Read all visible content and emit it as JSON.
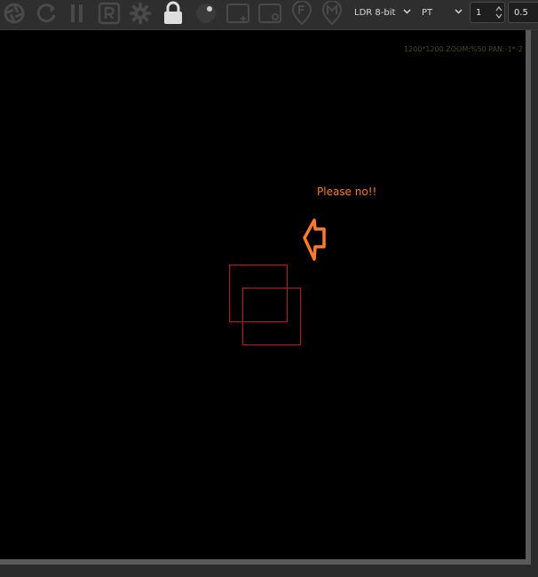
{
  "toolbar": {
    "icons": [
      "aperture-icon",
      "refresh-icon",
      "pause-icon",
      "render-r-icon",
      "settings-gear-icon",
      "lock-icon",
      "sphere-icon",
      "add-viewport-icon",
      "camera-region-icon",
      "focus-f-icon",
      "map-pin-m-icon"
    ],
    "color_mode": "LDR 8-bit",
    "mode": "PT",
    "value_1": "1",
    "value_2": "0.5"
  },
  "viewport": {
    "info": "1200*1200 ZOOM:%50  PAN:-1*-2",
    "annotation": "Please no!!",
    "annotation_color": "#ff7a2a",
    "region_color": "#c01818"
  }
}
